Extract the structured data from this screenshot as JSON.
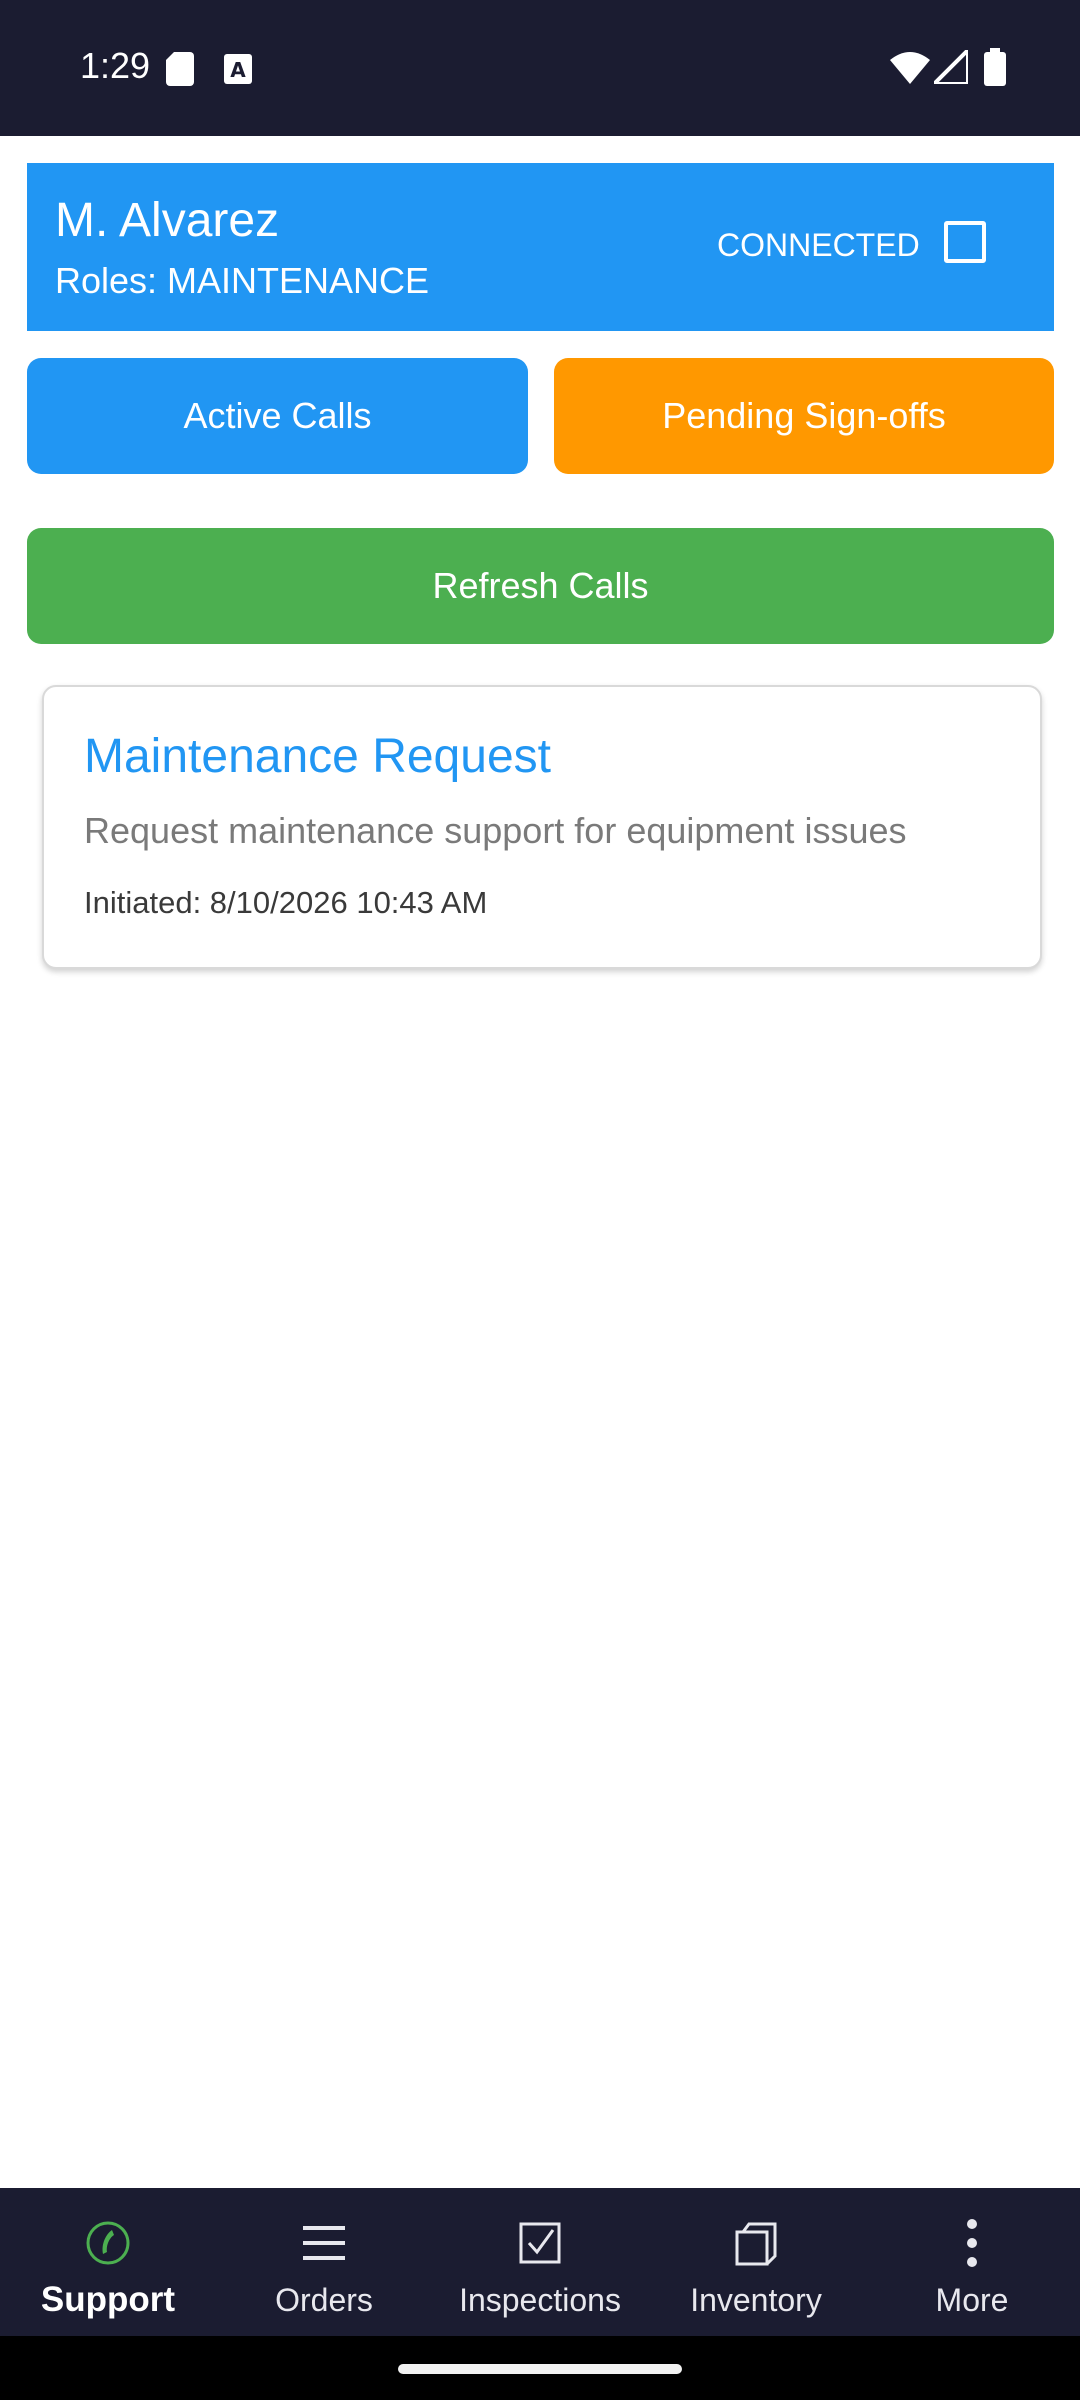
{
  "status_bar": {
    "time": "1:29",
    "icons": [
      "sd-card-icon",
      "keyboard-a-icon",
      "wifi-icon",
      "signal-icon",
      "battery-icon"
    ]
  },
  "header": {
    "user_name": "M. Alvarez",
    "roles": "Roles: MAINTENANCE",
    "connection_status": "CONNECTED"
  },
  "buttons": {
    "active_calls": "Active Calls",
    "pending_signoffs": "Pending Sign-offs",
    "refresh_calls": "Refresh Calls"
  },
  "calls": [
    {
      "title": "Maintenance Request",
      "description": "Request maintenance support for equipment issues",
      "initiated": "Initiated: 8/10/2026 10:43 AM"
    }
  ],
  "bottom_nav": {
    "items": [
      {
        "label": "Support",
        "icon": "phone-icon",
        "active": true
      },
      {
        "label": "Orders",
        "icon": "list-icon",
        "active": false
      },
      {
        "label": "Inspections",
        "icon": "checkbox-icon",
        "active": false
      },
      {
        "label": "Inventory",
        "icon": "inventory-icon",
        "active": false
      },
      {
        "label": "More",
        "icon": "more-vertical-icon",
        "active": false
      }
    ]
  },
  "colors": {
    "status_bar_bg": "#1b1c31",
    "header_blue": "#2196f3",
    "pending_orange": "#ff9800",
    "refresh_green": "#4caf50",
    "support_icon_green": "#4caf50"
  }
}
